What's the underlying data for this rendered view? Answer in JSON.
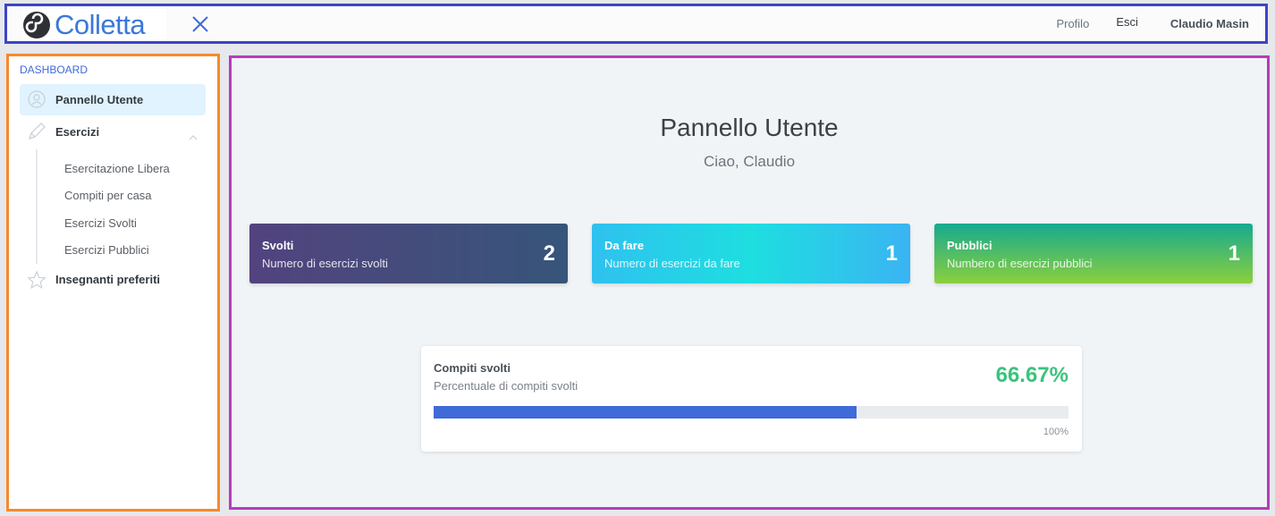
{
  "header": {
    "logo_text": "Colletta",
    "nav": {
      "profilo": "Profilo",
      "esci": "Esci",
      "user_name": "Claudio Masin"
    }
  },
  "sidebar": {
    "heading": "DASHBOARD",
    "items": [
      {
        "label": "Pannello Utente",
        "icon": "user-circle-icon",
        "active": true
      },
      {
        "label": "Esercizi",
        "icon": "pencil-icon",
        "expanded": true,
        "children": [
          "Esercitazione Libera",
          "Compiti per casa",
          "Esercizi Svolti",
          "Esercizi Pubblici"
        ]
      },
      {
        "label": "Insegnanti preferiti",
        "icon": "star-icon"
      }
    ]
  },
  "main": {
    "title": "Pannello Utente",
    "subtitle": "Ciao, Claudio",
    "cards": [
      {
        "title": "Svolti",
        "subtitle": "Numero di esercizi svolti",
        "value": "2"
      },
      {
        "title": "Da fare",
        "subtitle": "Numero di esercizi da fare",
        "value": "1"
      },
      {
        "title": "Pubblici",
        "subtitle": "Numbero di esercizi pubblici",
        "value": "1"
      }
    ],
    "progress": {
      "title": "Compiti svolti",
      "subtitle": "Percentuale di compiti svolti",
      "value_label": "66.67%",
      "fraction": 0.6667,
      "max_label": "100%"
    }
  },
  "colors": {
    "accent": "#3f6ad8",
    "success": "#3ac47d",
    "active_bg": "#e0f3ff"
  }
}
